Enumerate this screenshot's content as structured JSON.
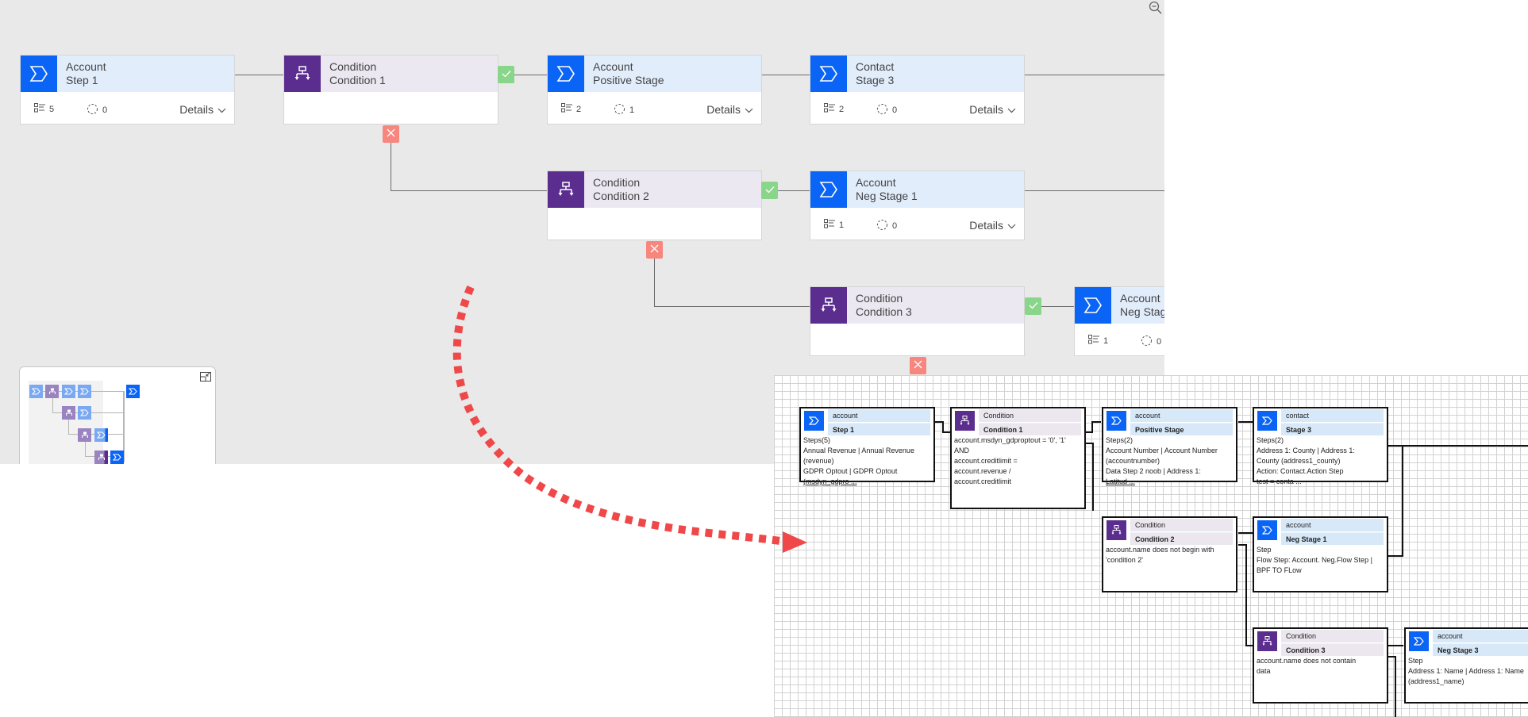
{
  "canvas": {
    "zoom_out_icon": "zoom-out-icon",
    "stages": [
      {
        "id": "step1",
        "kind": "stage",
        "entity": "Account",
        "name": "Step 1",
        "steps": "5",
        "workflows": "0",
        "details_label": "Details"
      },
      {
        "id": "cond1",
        "kind": "condition",
        "entity": "Condition",
        "name": "Condition 1"
      },
      {
        "id": "pos",
        "kind": "stage",
        "entity": "Account",
        "name": "Positive Stage",
        "steps": "2",
        "workflows": "1",
        "details_label": "Details"
      },
      {
        "id": "stage3",
        "kind": "stage",
        "entity": "Contact",
        "name": "Stage 3",
        "steps": "2",
        "workflows": "0",
        "details_label": "Details"
      },
      {
        "id": "cond2",
        "kind": "condition",
        "entity": "Condition",
        "name": "Condition 2"
      },
      {
        "id": "neg1",
        "kind": "stage",
        "entity": "Account",
        "name": "Neg Stage 1",
        "steps": "1",
        "workflows": "0",
        "details_label": "Details"
      },
      {
        "id": "cond3",
        "kind": "condition",
        "entity": "Condition",
        "name": "Condition 3"
      },
      {
        "id": "neg3",
        "kind": "stage",
        "entity": "Account",
        "name": "Neg Stage",
        "steps": "1",
        "workflows": "0"
      }
    ],
    "badges": {
      "true_icon": "checkmark-icon",
      "false_icon": "close-icon"
    },
    "colors": {
      "stage_icon_bg": "#0a64f6",
      "condition_icon_bg": "#5a2d8f",
      "stage_header_bg": "#e2edfc",
      "condition_header_bg": "#ebe8f1",
      "true_badge": "#89d68b",
      "false_badge": "#f7867e",
      "canvas_bg": "#e9e9e9"
    }
  },
  "minimap": {
    "expand_icon": "minimap-collapse-icon"
  },
  "annotation": {
    "arrow_color": "#f04848",
    "style": "dotted-curved-arrow"
  },
  "flow_diagram": {
    "cards": [
      {
        "kind": "stage",
        "entity": "account",
        "name": "Step 1",
        "body": [
          "Steps(5)",
          "Annual Revenue | Annual Revenue",
          "(revenue)",
          "GDPR Optout | GDPR Optout",
          "(msdyn_gdpro ..."
        ]
      },
      {
        "kind": "condition",
        "entity": "Condition",
        "name": "Condition 1",
        "body": [
          "account.msdyn_gdproptout = '0', '1'",
          "AND",
          "account.creditlimit =",
          "account.revenue /",
          "account.creditlimit"
        ]
      },
      {
        "kind": "stage",
        "entity": "account",
        "name": "Positive Stage",
        "body": [
          "Steps(2)",
          "Account Number | Account Number",
          "(accountnumber)",
          "Data Step 2 noob | Address 1:",
          "Latitud ..."
        ]
      },
      {
        "kind": "stage",
        "entity": "contact",
        "name": "Stage 3",
        "body": [
          "Steps(2)",
          "Address 1: County | Address 1:",
          "County (address1_county)",
          "Action: Contact.Action Step",
          "test = conta ..."
        ]
      },
      {
        "kind": "condition",
        "entity": "Condition",
        "name": "Condition 2",
        "body": [
          "account.name does not begin with",
          "'condition 2'"
        ]
      },
      {
        "kind": "stage",
        "entity": "account",
        "name": "Neg Stage 1",
        "body": [
          "Step",
          "Flow Step: Account. Neg.Flow Step |",
          "BPF TO FLow"
        ]
      },
      {
        "kind": "condition",
        "entity": "Condition",
        "name": "Condition 3",
        "body": [
          "account.name does not contain",
          "data"
        ]
      },
      {
        "kind": "stage",
        "entity": "account",
        "name": "Neg Stage 3",
        "body": [
          "Step",
          "Address 1: Name | Address 1: Name",
          "(address1_name)"
        ]
      }
    ]
  }
}
